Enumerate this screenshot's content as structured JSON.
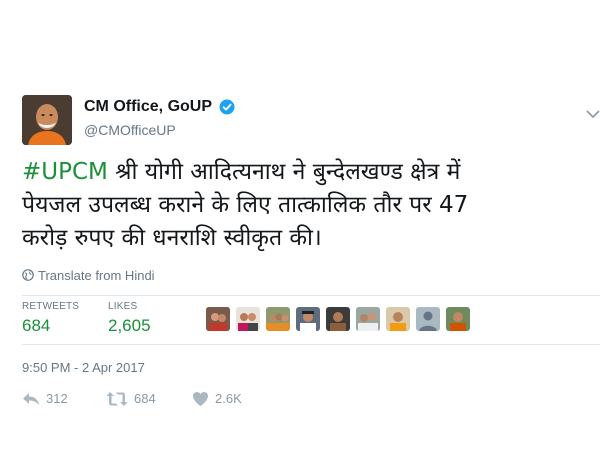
{
  "tweet": {
    "display_name": "CM Office, GoUP",
    "handle": "@CMOfficeUP",
    "hashtag": "#UPCM",
    "text_line1": " श्री योगी आदित्यनाथ ने बुन्देलखण्ड क्षेत्र में",
    "text_line2": "पेयजल उपलब्ध कराने के लिए तात्कालिक तौर पर 47",
    "text_line3": "करोड़ रुपए की धनराशि स्वीकृत की।",
    "translate_label": "Translate from Hindi",
    "timestamp": "9:50 PM - 2 Apr 2017"
  },
  "stats": {
    "retweets_label": "RETWEETS",
    "retweets_value": "684",
    "likes_label": "LIKES",
    "likes_value": "2,605"
  },
  "actions": {
    "reply_count": "312",
    "retweet_count": "684",
    "like_count": "2.6K"
  },
  "colors": {
    "accent": "#1b8f3a",
    "verified": "#1da1f2",
    "muted": "#657786"
  }
}
